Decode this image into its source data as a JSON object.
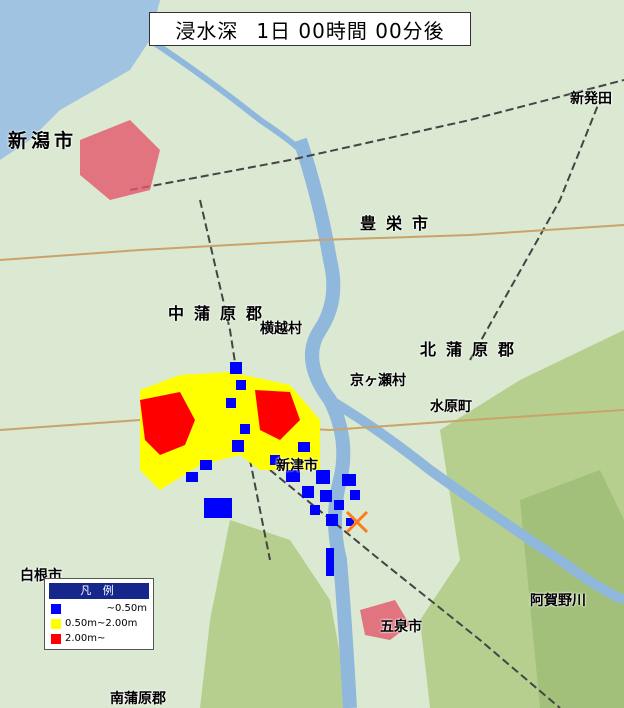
{
  "header": {
    "label": "浸水深",
    "time": "1日 00時間 00分後"
  },
  "places": [
    {
      "name": "新潟市"
    },
    {
      "name": "豊栄市"
    },
    {
      "name": "北蒲原郡"
    },
    {
      "name": "中蒲原郡"
    },
    {
      "name": "新津市"
    },
    {
      "name": "五泉市"
    },
    {
      "name": "新発田"
    },
    {
      "name": "南蒲原郡"
    },
    {
      "name": "白根市"
    },
    {
      "name": "横越村"
    },
    {
      "name": "京ヶ瀬村"
    },
    {
      "name": "水原町"
    },
    {
      "name": "阿賀野川"
    }
  ],
  "legend": {
    "title": "凡 例",
    "items": [
      {
        "label": "~0.50m",
        "color": "#0000ff"
      },
      {
        "label": "0.50m~2.00m",
        "color": "#ffff00"
      },
      {
        "label": "2.00m~",
        "color": "#ff0000"
      }
    ]
  },
  "colors": {
    "land": "#dbe9d2",
    "sea": "#9fc3e0",
    "river": "#8fb8dc",
    "hills": "#b6cf8e",
    "flood_shallow": "#0000ff",
    "flood_mid": "#ffff00",
    "flood_deep": "#ff0000",
    "breach_marker": "#ff7a1a"
  },
  "icons": {
    "breach": "x-mark-icon"
  }
}
